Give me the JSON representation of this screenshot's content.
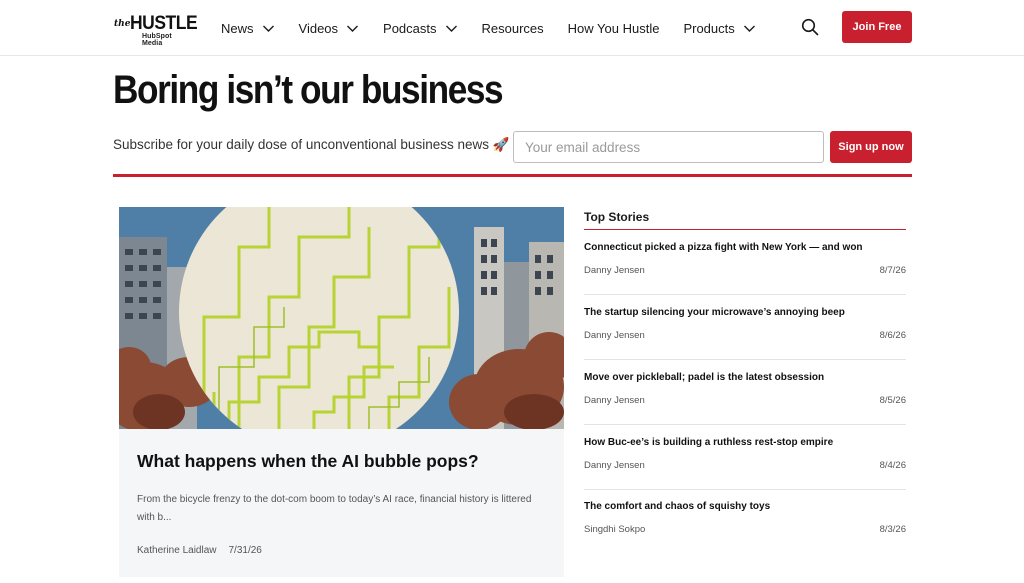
{
  "header": {
    "logo": {
      "the": "the",
      "main": "HUSTLE",
      "sub": "HubSpot Media"
    },
    "nav": [
      {
        "label": "News",
        "has_dropdown": true
      },
      {
        "label": "Videos",
        "has_dropdown": true
      },
      {
        "label": "Podcasts",
        "has_dropdown": true
      },
      {
        "label": "Resources",
        "has_dropdown": false
      },
      {
        "label": "How You Hustle",
        "has_dropdown": false
      },
      {
        "label": "Products",
        "has_dropdown": true
      }
    ],
    "search_icon": "search-icon",
    "join_label": "Join Free"
  },
  "hero": {
    "headline": "Boring isn’t our business",
    "subscribe_text": "Subscribe for your daily dose of unconventional business news 🚀",
    "email_placeholder": "Your email address",
    "signup_label": "Sign up now"
  },
  "feature": {
    "title": "What happens when the AI bubble pops?",
    "excerpt": "From the bicycle frenzy to the dot-com boom to today’s AI race, financial history is littered with b...",
    "author": "Katherine Laidlaw",
    "date": "7/31/26"
  },
  "top_stories": {
    "heading": "Top Stories",
    "items": [
      {
        "title": "Connecticut picked a pizza fight with New York — and won",
        "author": "Danny Jensen",
        "date": "8/7/26"
      },
      {
        "title": "The startup silencing your microwave’s annoying beep",
        "author": "Danny Jensen",
        "date": "8/6/26"
      },
      {
        "title": "Move over pickleball; padel is the latest obsession",
        "author": "Danny Jensen",
        "date": "8/5/26"
      },
      {
        "title": "How Buc-ee’s is building a ruthless rest-stop empire",
        "author": "Danny Jensen",
        "date": "8/4/26"
      },
      {
        "title": "The comfort and chaos of squishy toys",
        "author": "Singdhi Sokpo",
        "date": "8/3/26"
      }
    ]
  },
  "colors": {
    "brand_red": "#c8202f",
    "sky_blue": "#4f7fa6",
    "foliage": "#8a4a33",
    "circle": "#ece6d6",
    "circuit": "#b8d334"
  }
}
